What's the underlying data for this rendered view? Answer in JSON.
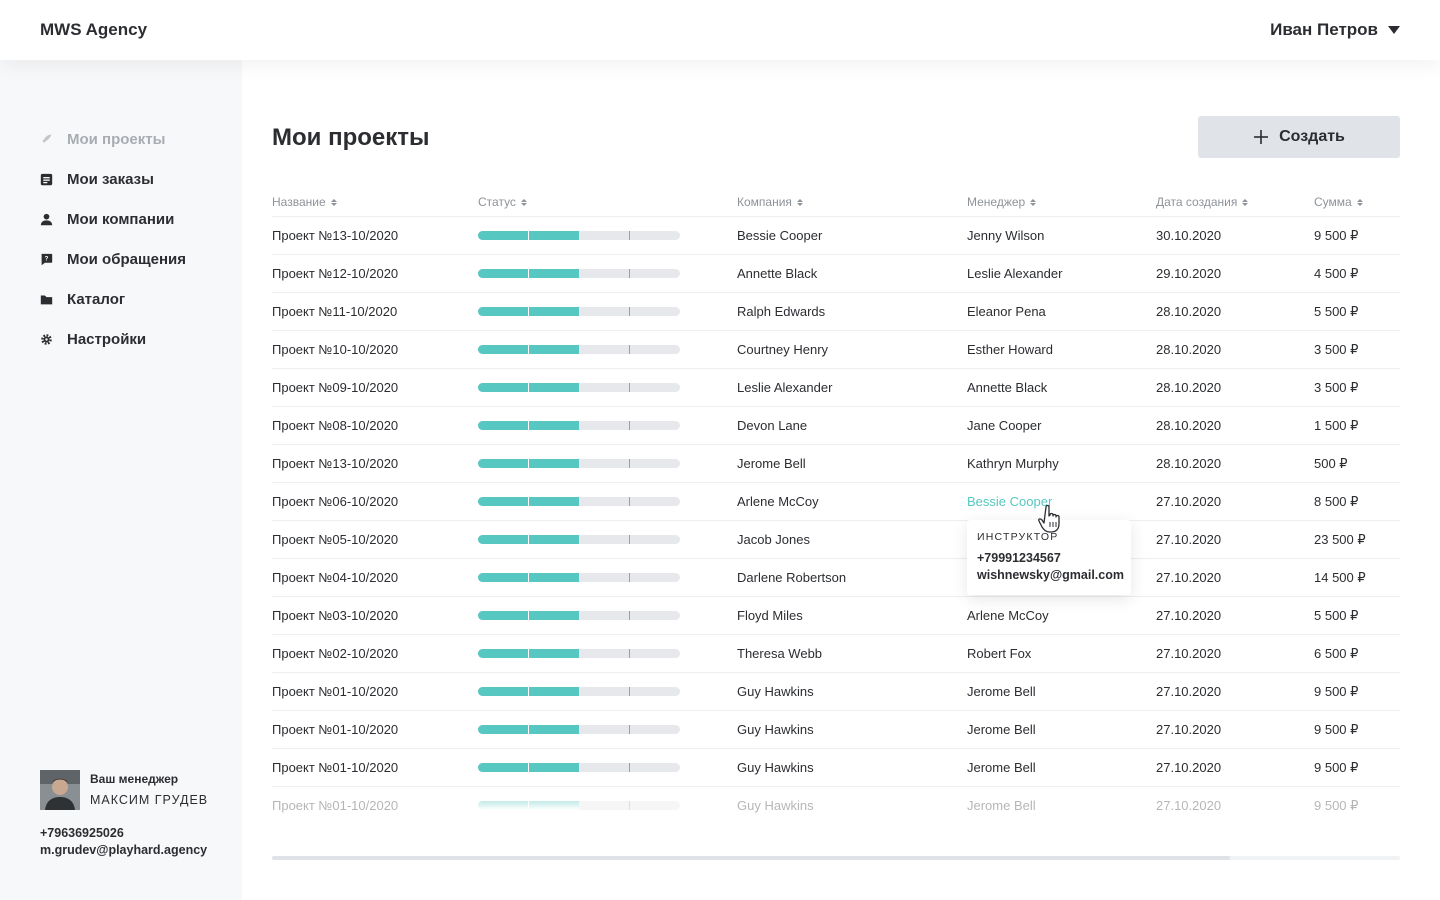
{
  "header": {
    "logo": "MWS Agency",
    "user_name": "Иван Петров"
  },
  "sidebar": {
    "items": [
      {
        "label": "Мои проекты",
        "icon": "rocket-icon",
        "active": true
      },
      {
        "label": "Мои заказы",
        "icon": "document-icon"
      },
      {
        "label": "Мои компании",
        "icon": "user-icon"
      },
      {
        "label": "Мои обращения",
        "icon": "chat-question-icon"
      },
      {
        "label": "Каталог",
        "icon": "folder-icon"
      },
      {
        "label": "Настройки",
        "icon": "gear-icon"
      }
    ],
    "manager": {
      "label": "Ваш менеджер",
      "name": "МАКСИМ ГРУДЕВ",
      "phone": "+79636925026",
      "email": "m.grudev@playhard.agency"
    }
  },
  "main": {
    "title": "Мои проекты",
    "create_label": "Создать",
    "columns": {
      "name": "Название",
      "status": "Статус",
      "company": "Компания",
      "manager": "Менеджер",
      "date": "Дата создания",
      "sum": "Сумма"
    },
    "rows": [
      {
        "name": "Проект №13-10/2020",
        "company": "Bessie Cooper",
        "manager": "Jenny Wilson",
        "date": "30.10.2020",
        "sum": "9 500 ₽",
        "progress": 0.5
      },
      {
        "name": "Проект №12-10/2020",
        "company": "Annette Black",
        "manager": "Leslie Alexander",
        "date": "29.10.2020",
        "sum": "4 500 ₽",
        "progress": 0.5
      },
      {
        "name": "Проект №11-10/2020",
        "company": "Ralph Edwards",
        "manager": "Eleanor Pena",
        "date": "28.10.2020",
        "sum": "5 500 ₽",
        "progress": 0.5
      },
      {
        "name": "Проект №10-10/2020",
        "company": "Courtney Henry",
        "manager": "Esther Howard",
        "date": "28.10.2020",
        "sum": "3 500 ₽",
        "progress": 0.5
      },
      {
        "name": "Проект №09-10/2020",
        "company": "Leslie Alexander",
        "manager": "Annette Black",
        "date": "28.10.2020",
        "sum": "3 500 ₽",
        "progress": 0.5
      },
      {
        "name": "Проект №08-10/2020",
        "company": "Devon Lane",
        "manager": "Jane Cooper",
        "date": "28.10.2020",
        "sum": "1 500 ₽",
        "progress": 0.5
      },
      {
        "name": "Проект №13-10/2020",
        "company": "Jerome Bell",
        "manager": "Kathryn Murphy",
        "date": "28.10.2020",
        "sum": "500 ₽",
        "progress": 0.5
      },
      {
        "name": "Проект №06-10/2020",
        "company": "Arlene McCoy",
        "manager": "Bessie Cooper",
        "date": "27.10.2020",
        "sum": "8 500 ₽",
        "progress": 0.5,
        "highlight": true
      },
      {
        "name": "Проект №05-10/2020",
        "company": "Jacob Jones",
        "manager": "",
        "date": "27.10.2020",
        "sum": "23 500 ₽",
        "progress": 0.5
      },
      {
        "name": "Проект №04-10/2020",
        "company": "Darlene Robertson",
        "manager": "",
        "date": "27.10.2020",
        "sum": "14 500 ₽",
        "progress": 0.5
      },
      {
        "name": "Проект №03-10/2020",
        "company": "Floyd Miles",
        "manager": "Arlene McCoy",
        "date": "27.10.2020",
        "sum": "5 500 ₽",
        "progress": 0.5
      },
      {
        "name": "Проект №02-10/2020",
        "company": "Theresa Webb",
        "manager": "Robert Fox",
        "date": "27.10.2020",
        "sum": "6 500 ₽",
        "progress": 0.5
      },
      {
        "name": "Проект №01-10/2020",
        "company": "Guy Hawkins",
        "manager": "Jerome Bell",
        "date": "27.10.2020",
        "sum": "9 500 ₽",
        "progress": 0.5
      },
      {
        "name": "Проект №01-10/2020",
        "company": "Guy Hawkins",
        "manager": "Jerome Bell",
        "date": "27.10.2020",
        "sum": "9 500 ₽",
        "progress": 0.5
      },
      {
        "name": "Проект №01-10/2020",
        "company": "Guy Hawkins",
        "manager": "Jerome Bell",
        "date": "27.10.2020",
        "sum": "9 500 ₽",
        "progress": 0.5
      },
      {
        "name": "Проект №01-10/2020",
        "company": "Guy Hawkins",
        "manager": "Jerome Bell",
        "date": "27.10.2020",
        "sum": "9 500 ₽",
        "progress": 0.5,
        "faded": true
      }
    ],
    "tooltip": {
      "role": "ИНСТРУКТОР",
      "phone": "+79991234567",
      "email": "wishnewsky@gmail.com"
    }
  },
  "colors": {
    "accent": "#56c8c1",
    "track": "#e6e8eb",
    "sidebar_bg": "#f7f8f9",
    "button_bg": "#e0e3e7"
  }
}
